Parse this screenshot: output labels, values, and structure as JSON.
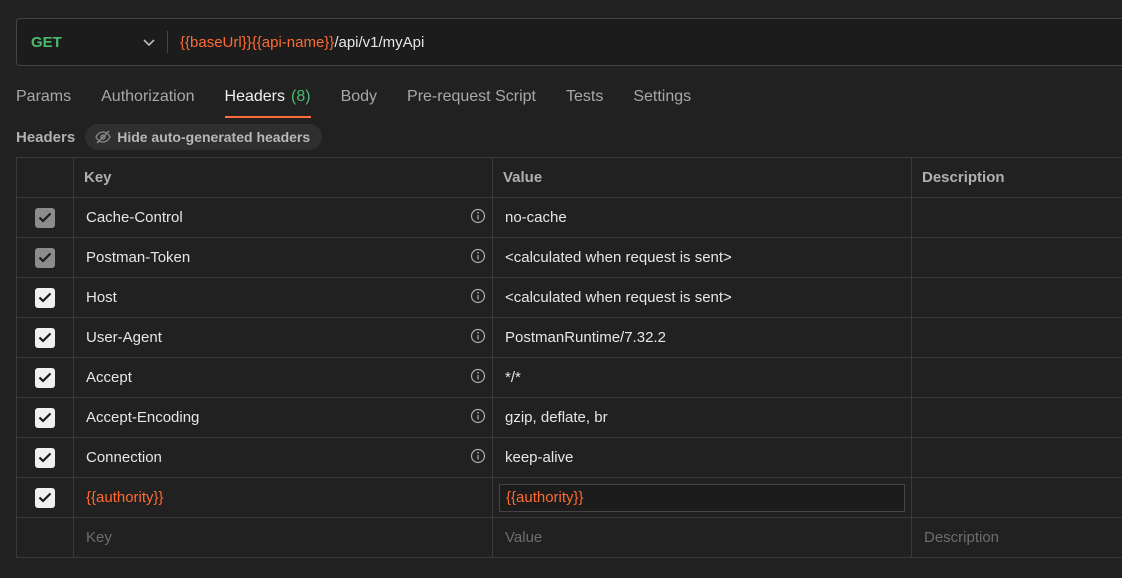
{
  "request": {
    "method": "GET",
    "url_parts": {
      "base": "{{baseUrl}}",
      "api": "{{api-name}}",
      "path": "/api/v1/myApi"
    }
  },
  "tabs": [
    {
      "label": "Params"
    },
    {
      "label": "Authorization"
    },
    {
      "label": "Headers",
      "count": "(8)",
      "active": true
    },
    {
      "label": "Body"
    },
    {
      "label": "Pre-request Script"
    },
    {
      "label": "Tests"
    },
    {
      "label": "Settings"
    }
  ],
  "headers_section": {
    "title": "Headers",
    "toggle_label": "Hide auto-generated headers"
  },
  "table": {
    "columns": {
      "key": "Key",
      "value": "Value",
      "description": "Description"
    },
    "rows": [
      {
        "key": "Cache-Control",
        "value": "no-cache",
        "checked": true,
        "disabled": true
      },
      {
        "key": "Postman-Token",
        "value": "<calculated when request is sent>",
        "checked": true,
        "disabled": true
      },
      {
        "key": "Host",
        "value": "<calculated when request is sent>",
        "checked": true
      },
      {
        "key": "User-Agent",
        "value": "PostmanRuntime/7.32.2",
        "checked": true
      },
      {
        "key": "Accept",
        "value": "*/*",
        "checked": true
      },
      {
        "key": "Accept-Encoding",
        "value": "gzip, deflate, br",
        "checked": true
      },
      {
        "key": "Connection",
        "value": "keep-alive",
        "checked": true
      },
      {
        "key": "{{authority}}",
        "value": "{{authority}}",
        "checked": true
      }
    ],
    "new_row": {
      "key_placeholder": "Key",
      "value_placeholder": "Value",
      "description_placeholder": "Description"
    }
  },
  "colors": {
    "accent": "#ff6c37",
    "variable": "#ff6a33",
    "method": "#4dbb6d"
  }
}
